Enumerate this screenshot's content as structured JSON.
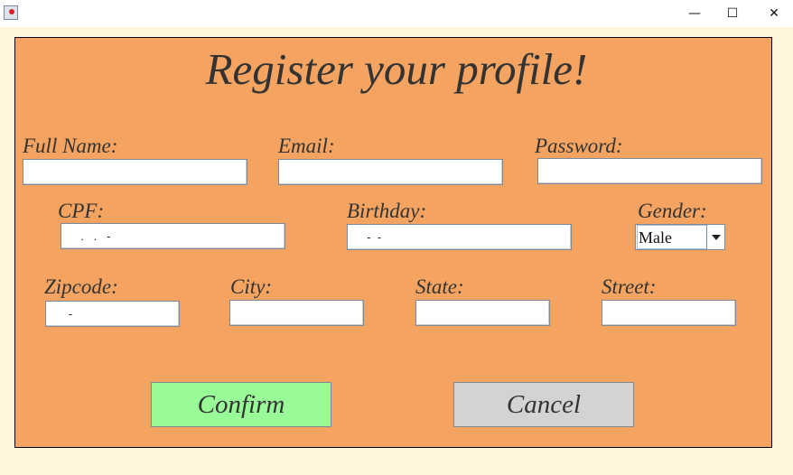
{
  "window": {
    "minimize": "—",
    "maximize": "☐",
    "close": "✕"
  },
  "form": {
    "title": "Register your profile!",
    "full_name": {
      "label": "Full Name:",
      "value": ""
    },
    "email": {
      "label": "Email:",
      "value": ""
    },
    "password": {
      "label": "Password:",
      "value": ""
    },
    "cpf": {
      "label": "CPF:",
      "value": "  .   .   -"
    },
    "birthday": {
      "label": "Birthday:",
      "value": "  -  -"
    },
    "gender": {
      "label": "Gender:",
      "value": "Male"
    },
    "zipcode": {
      "label": "Zipcode:",
      "value": "   -"
    },
    "city": {
      "label": "City:",
      "value": ""
    },
    "state": {
      "label": "State:",
      "value": ""
    },
    "street": {
      "label": "Street:",
      "value": ""
    }
  },
  "buttons": {
    "confirm": "Confirm",
    "cancel": "Cancel"
  },
  "colors": {
    "panel": "#f4a460",
    "confirm": "#98fb98",
    "cancel": "#d3d3d3",
    "background": "#fff6dc"
  }
}
